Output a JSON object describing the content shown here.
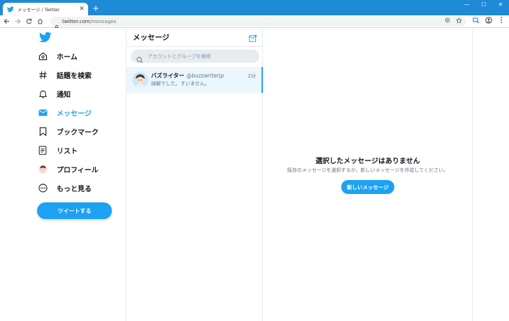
{
  "browser": {
    "tab_title": "メッセージ / Twitter",
    "tab_close": "✕",
    "new_tab": "+",
    "url_host": "twitter.com",
    "url_path": "/messages",
    "window_controls": [
      "—",
      "☐",
      "✕"
    ]
  },
  "nav": {
    "items": [
      {
        "label": "ホーム",
        "icon": "home-icon"
      },
      {
        "label": "話題を検索",
        "icon": "hashtag-icon"
      },
      {
        "label": "通知",
        "icon": "bell-icon"
      },
      {
        "label": "メッセージ",
        "icon": "envelope-icon",
        "active": true
      },
      {
        "label": "ブックマーク",
        "icon": "bookmark-icon"
      },
      {
        "label": "リスト",
        "icon": "list-icon"
      },
      {
        "label": "プロフィール",
        "icon": "avatar-icon"
      },
      {
        "label": "もっと見る",
        "icon": "more-icon"
      }
    ],
    "tweet_button": "ツイートする"
  },
  "messages": {
    "title": "メッセージ",
    "search_placeholder": "アカウントとグループを検索",
    "conversations": [
      {
        "name": "バズライター",
        "handle": "@buzzwriterjp",
        "time": "2分",
        "preview": "誤解でした。すいません。"
      }
    ]
  },
  "detail": {
    "empty_title": "選択したメッセージはありません",
    "empty_desc": "既存のメッセージを選択するか、新しいメッセージを作成してください。",
    "new_message_button": "新しいメッセージ"
  },
  "colors": {
    "accent": "#1da1f2",
    "titlebar": "#1f8ad6",
    "active_row": "#ebf6fd"
  }
}
